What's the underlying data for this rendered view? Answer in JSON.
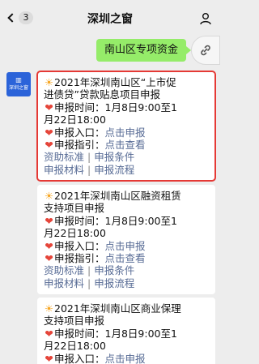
{
  "header": {
    "back_count": "3",
    "title": "深圳之窗"
  },
  "outgoing": {
    "text": "南山区专项资金"
  },
  "sender": {
    "avatar_text": "深圳之窗"
  },
  "messages": [
    {
      "title1": "2021年深圳南山区“上市促",
      "title2": "进债贷”贷款贴息项目申报",
      "time_label": "申报时间：",
      "time1": "1月8日9:00至1",
      "time2": "月22日18:00",
      "entry_label": "申报入口：",
      "entry_link": "点击申报",
      "guide_label": "申报指引：",
      "guide_link": "点击查看",
      "links_row1": [
        "资助标准",
        "申报条件"
      ],
      "links_row2": [
        "申报材料",
        "申报流程"
      ]
    },
    {
      "title1": "2021年深圳南山区融资租赁",
      "title2": "支持项目申报",
      "time_label": "申报时间：",
      "time1": "1月8日9:00至1",
      "time2": "月22日18:00",
      "entry_label": "申报入口：",
      "entry_link": "点击申报",
      "guide_label": "申报指引：",
      "guide_link": "点击查看",
      "links_row1": [
        "资助标准",
        "申报条件"
      ],
      "links_row2": [
        "申报材料",
        "申报流程"
      ]
    },
    {
      "title1": "2021年深圳南山区商业保理",
      "title2": "支持项目申报",
      "time_label": "申报时间：",
      "time1": "1月8日9:00至1",
      "time2": "月22日18:00",
      "entry_label": "申报入口：",
      "entry_link": "点击申报"
    }
  ],
  "separator": "|",
  "icons": {
    "sun": "sun-emoji-icon",
    "heart": "heart-emoji-icon",
    "link": "link-icon",
    "user": "user-icon",
    "back": "chevron-left-icon"
  }
}
